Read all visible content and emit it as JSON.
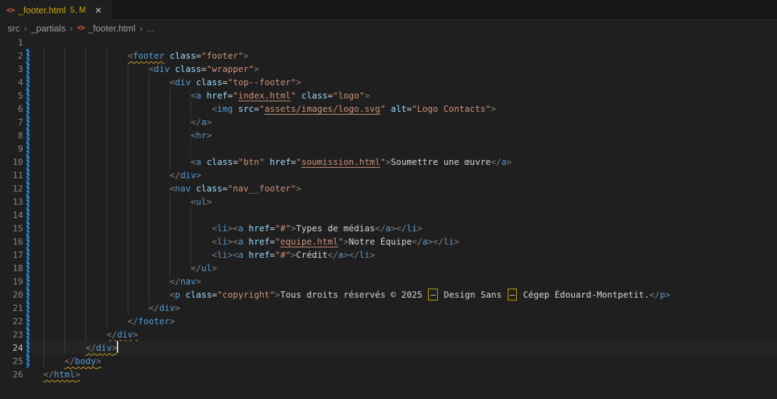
{
  "tab": {
    "filename": "_footer.html",
    "badge": "5, M"
  },
  "icons": {
    "html_file": "<>",
    "close": "✕",
    "chevron": "›"
  },
  "breadcrumbs": {
    "items": [
      {
        "label": "src"
      },
      {
        "label": "_partials"
      },
      {
        "label": "_footer.html",
        "icon": "html_file"
      },
      {
        "label": "..."
      }
    ]
  },
  "colors": {
    "editor_bg": "#1f1f1f",
    "tabbar_bg": "#181818",
    "warning": "#cca700",
    "modified_gutter_blue": "#3c95e8",
    "tag": "#569cd6",
    "attribute": "#9cdcfe",
    "string": "#ce9178",
    "punctuation": "#808080",
    "text": "#d4d4d4",
    "html_icon_orange": "#e0603a"
  },
  "editor": {
    "cursor_line": 24,
    "lines": [
      {
        "n": 1,
        "indent": 0,
        "mod": false,
        "tokens": []
      },
      {
        "n": 2,
        "indent": 16,
        "mod": true,
        "tokens": [
          [
            "p",
            "<",
            "q"
          ],
          [
            "t",
            "footer",
            "q"
          ],
          [
            "x",
            " "
          ],
          [
            "a",
            "class"
          ],
          [
            "x",
            "="
          ],
          [
            "s",
            "\"footer\""
          ],
          [
            "p",
            ">"
          ]
        ]
      },
      {
        "n": 3,
        "indent": 20,
        "mod": true,
        "tokens": [
          [
            "p",
            "<"
          ],
          [
            "t",
            "div"
          ],
          [
            "x",
            " "
          ],
          [
            "a",
            "class"
          ],
          [
            "x",
            "="
          ],
          [
            "s",
            "\"wrapper\""
          ],
          [
            "p",
            ">"
          ]
        ]
      },
      {
        "n": 4,
        "indent": 24,
        "mod": true,
        "tokens": [
          [
            "p",
            "<"
          ],
          [
            "t",
            "div"
          ],
          [
            "x",
            " "
          ],
          [
            "a",
            "class"
          ],
          [
            "x",
            "="
          ],
          [
            "s",
            "\"top--footer\""
          ],
          [
            "p",
            ">"
          ]
        ]
      },
      {
        "n": 5,
        "indent": 28,
        "mod": true,
        "tokens": [
          [
            "p",
            "<"
          ],
          [
            "t",
            "a"
          ],
          [
            "x",
            " "
          ],
          [
            "a",
            "href"
          ],
          [
            "x",
            "="
          ],
          [
            "s",
            "\""
          ],
          [
            "u",
            "index.html"
          ],
          [
            "s",
            "\""
          ],
          [
            "x",
            " "
          ],
          [
            "a",
            "class"
          ],
          [
            "x",
            "="
          ],
          [
            "s",
            "\"logo\""
          ],
          [
            "p",
            ">"
          ]
        ]
      },
      {
        "n": 6,
        "indent": 32,
        "mod": true,
        "tokens": [
          [
            "p",
            "<"
          ],
          [
            "t",
            "img"
          ],
          [
            "x",
            " "
          ],
          [
            "a",
            "src"
          ],
          [
            "x",
            "="
          ],
          [
            "s",
            "\""
          ],
          [
            "u",
            "assets/images/logo.svg"
          ],
          [
            "s",
            "\""
          ],
          [
            "x",
            " "
          ],
          [
            "a",
            "alt"
          ],
          [
            "x",
            "="
          ],
          [
            "s",
            "\"Logo Contacts\""
          ],
          [
            "p",
            ">"
          ]
        ]
      },
      {
        "n": 7,
        "indent": 28,
        "mod": true,
        "tokens": [
          [
            "p",
            "</"
          ],
          [
            "t",
            "a"
          ],
          [
            "p",
            ">"
          ]
        ]
      },
      {
        "n": 8,
        "indent": 28,
        "mod": true,
        "tokens": [
          [
            "p",
            "<"
          ],
          [
            "t",
            "hr"
          ],
          [
            "p",
            ">"
          ]
        ]
      },
      {
        "n": 9,
        "indent": 28,
        "mod": true,
        "tokens": []
      },
      {
        "n": 10,
        "indent": 28,
        "mod": true,
        "tokens": [
          [
            "p",
            "<"
          ],
          [
            "t",
            "a"
          ],
          [
            "x",
            " "
          ],
          [
            "a",
            "class"
          ],
          [
            "x",
            "="
          ],
          [
            "s",
            "\"btn\""
          ],
          [
            "x",
            " "
          ],
          [
            "a",
            "href"
          ],
          [
            "x",
            "="
          ],
          [
            "s",
            "\""
          ],
          [
            "u",
            "soumission.html"
          ],
          [
            "s",
            "\""
          ],
          [
            "p",
            ">"
          ],
          [
            "x",
            "Soumettre une œuvre"
          ],
          [
            "p",
            "</"
          ],
          [
            "t",
            "a"
          ],
          [
            "p",
            ">"
          ]
        ]
      },
      {
        "n": 11,
        "indent": 24,
        "mod": true,
        "tokens": [
          [
            "p",
            "</"
          ],
          [
            "t",
            "div"
          ],
          [
            "p",
            ">"
          ]
        ]
      },
      {
        "n": 12,
        "indent": 24,
        "mod": true,
        "tokens": [
          [
            "p",
            "<"
          ],
          [
            "t",
            "nav"
          ],
          [
            "x",
            " "
          ],
          [
            "a",
            "class"
          ],
          [
            "x",
            "="
          ],
          [
            "s",
            "\"nav__footer\""
          ],
          [
            "p",
            ">"
          ]
        ]
      },
      {
        "n": 13,
        "indent": 28,
        "mod": true,
        "tokens": [
          [
            "p",
            "<"
          ],
          [
            "t",
            "ul"
          ],
          [
            "p",
            ">"
          ]
        ]
      },
      {
        "n": 14,
        "indent": 32,
        "mod": true,
        "tokens": []
      },
      {
        "n": 15,
        "indent": 32,
        "mod": true,
        "tokens": [
          [
            "p",
            "<"
          ],
          [
            "t",
            "li"
          ],
          [
            "p",
            "><"
          ],
          [
            "t",
            "a"
          ],
          [
            "x",
            " "
          ],
          [
            "a",
            "href"
          ],
          [
            "x",
            "="
          ],
          [
            "s",
            "\"#\""
          ],
          [
            "p",
            ">"
          ],
          [
            "x",
            "Types de médias"
          ],
          [
            "p",
            "</"
          ],
          [
            "t",
            "a"
          ],
          [
            "p",
            "></"
          ],
          [
            "t",
            "li"
          ],
          [
            "p",
            ">"
          ]
        ]
      },
      {
        "n": 16,
        "indent": 32,
        "mod": true,
        "tokens": [
          [
            "p",
            "<"
          ],
          [
            "t",
            "li"
          ],
          [
            "p",
            "><"
          ],
          [
            "t",
            "a"
          ],
          [
            "x",
            " "
          ],
          [
            "a",
            "href"
          ],
          [
            "x",
            "="
          ],
          [
            "s",
            "\""
          ],
          [
            "u",
            "equipe.html"
          ],
          [
            "s",
            "\""
          ],
          [
            "p",
            ">"
          ],
          [
            "x",
            "Notre Équipe"
          ],
          [
            "p",
            "</"
          ],
          [
            "t",
            "a"
          ],
          [
            "p",
            "></"
          ],
          [
            "t",
            "li"
          ],
          [
            "p",
            ">"
          ]
        ]
      },
      {
        "n": 17,
        "indent": 32,
        "mod": true,
        "tokens": [
          [
            "p",
            "<"
          ],
          [
            "t",
            "li"
          ],
          [
            "p",
            "><"
          ],
          [
            "t",
            "a"
          ],
          [
            "x",
            " "
          ],
          [
            "a",
            "href"
          ],
          [
            "x",
            "="
          ],
          [
            "s",
            "\"#\""
          ],
          [
            "p",
            ">"
          ],
          [
            "x",
            "Crédit"
          ],
          [
            "p",
            "</"
          ],
          [
            "t",
            "a"
          ],
          [
            "p",
            "></"
          ],
          [
            "t",
            "li"
          ],
          [
            "p",
            ">"
          ]
        ]
      },
      {
        "n": 18,
        "indent": 28,
        "mod": true,
        "tokens": [
          [
            "p",
            "</"
          ],
          [
            "t",
            "ul"
          ],
          [
            "p",
            ">"
          ]
        ]
      },
      {
        "n": 19,
        "indent": 24,
        "mod": true,
        "tokens": [
          [
            "p",
            "</"
          ],
          [
            "t",
            "nav"
          ],
          [
            "p",
            ">"
          ]
        ]
      },
      {
        "n": 20,
        "indent": 24,
        "mod": true,
        "tokens": [
          [
            "p",
            "<"
          ],
          [
            "t",
            "p"
          ],
          [
            "x",
            " "
          ],
          [
            "a",
            "class"
          ],
          [
            "x",
            "="
          ],
          [
            "s",
            "\"copyright\""
          ],
          [
            "p",
            ">"
          ],
          [
            "x",
            "Tous droits réservés © 2025 "
          ],
          [
            "b",
            "–"
          ],
          [
            "x",
            " Design Sans "
          ],
          [
            "b",
            "–"
          ],
          [
            "x",
            " Cégep Édouard-Montpetit."
          ],
          [
            "p",
            "</"
          ],
          [
            "t",
            "p"
          ],
          [
            "p",
            ">"
          ]
        ]
      },
      {
        "n": 21,
        "indent": 20,
        "mod": true,
        "tokens": [
          [
            "p",
            "</"
          ],
          [
            "t",
            "div"
          ],
          [
            "p",
            ">"
          ]
        ]
      },
      {
        "n": 22,
        "indent": 16,
        "mod": true,
        "tokens": [
          [
            "p",
            "</"
          ],
          [
            "t",
            "footer"
          ],
          [
            "p",
            ">"
          ]
        ]
      },
      {
        "n": 23,
        "indent": 12,
        "mod": true,
        "tokens": [
          [
            "p",
            "</",
            "q"
          ],
          [
            "t",
            "div",
            "q"
          ],
          [
            "p",
            ">",
            "q"
          ]
        ]
      },
      {
        "n": 24,
        "indent": 8,
        "mod": true,
        "tokens": [
          [
            "p",
            "</",
            "q"
          ],
          [
            "t",
            "div",
            "q"
          ],
          [
            "p",
            ">",
            "q"
          ]
        ]
      },
      {
        "n": 25,
        "indent": 4,
        "mod": true,
        "tokens": [
          [
            "p",
            "</",
            "q"
          ],
          [
            "t",
            "body",
            "q"
          ],
          [
            "p",
            ">",
            "q"
          ]
        ]
      },
      {
        "n": 26,
        "indent": 0,
        "mod": false,
        "tokens": [
          [
            "p",
            "</",
            "q"
          ],
          [
            "t",
            "html",
            "q"
          ],
          [
            "p",
            ">",
            "q"
          ]
        ]
      }
    ]
  }
}
